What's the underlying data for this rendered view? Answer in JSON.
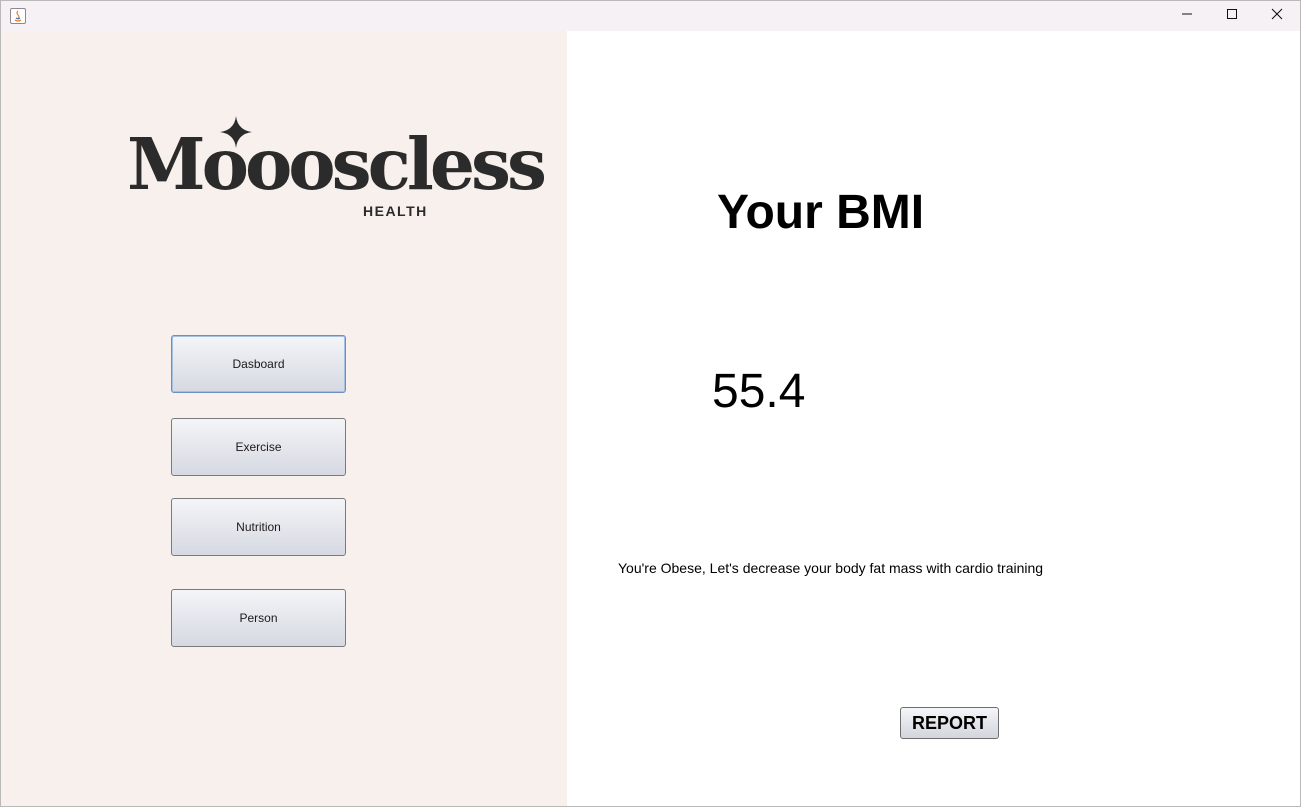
{
  "window": {
    "controls": {
      "minimize_icon": "minimize-icon",
      "maximize_icon": "maximize-icon",
      "close_icon": "close-icon"
    }
  },
  "sidebar": {
    "background": "#f8f0ed",
    "logo": {
      "wordmark": "Moooscless",
      "tagline": "HEALTH"
    },
    "nav": [
      {
        "label": "Dasboard",
        "focused": true
      },
      {
        "label": "Exercise"
      },
      {
        "label": "Nutrition"
      },
      {
        "label": "Person"
      }
    ]
  },
  "main": {
    "title": "Your BMI",
    "bmi_value": "55.4",
    "message": "You're Obese, Let's decrease your body fat mass with cardio training",
    "report_button": "REPORT"
  }
}
